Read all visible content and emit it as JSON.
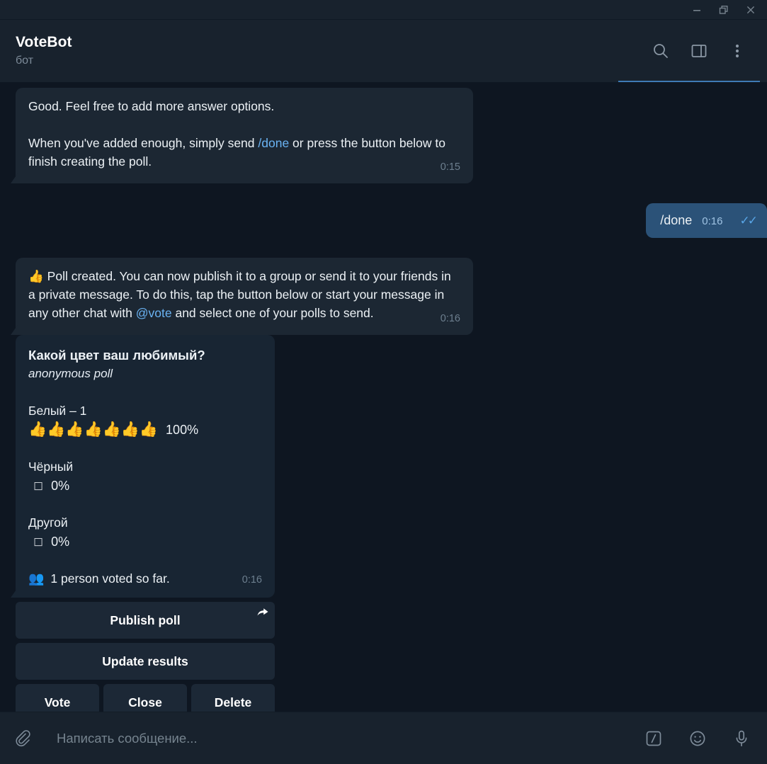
{
  "window": {
    "minimize_label": "Minimize",
    "restore_label": "Restore",
    "close_label": "Close"
  },
  "header": {
    "title": "VoteBot",
    "status": "бот",
    "search_icon": "search-icon",
    "panel_icon": "sidebar-toggle-icon",
    "menu_icon": "more-vertical-icon"
  },
  "messages": [
    {
      "id": "msg-instructions",
      "direction": "in",
      "paragraph1": "Good. Feel free to add more answer options.",
      "paragraph2_before": "When you've added enough, simply send ",
      "paragraph2_command": "/done",
      "paragraph2_after": " or press the button below to finish creating the poll.",
      "time": "0:15"
    },
    {
      "id": "msg-done",
      "direction": "out",
      "text": "/done",
      "time": "0:16",
      "ticks": "✓✓"
    },
    {
      "id": "msg-poll-created",
      "direction": "in",
      "emoji": "👍",
      "text_before": " Poll created. You can now publish it to a group or send it to your friends in a private message. To do this, tap the button below or start your message in any other chat with ",
      "mention": "@vote",
      "text_after": " and select one of your polls to send.",
      "time": "0:16"
    }
  ],
  "poll": {
    "question": "Какой цвет ваш любимый?",
    "subtitle": "anonymous poll",
    "options": [
      {
        "label": "Белый – 1",
        "emoji_bar": "👍👍👍👍👍👍👍",
        "box": "",
        "percent": "100%"
      },
      {
        "label": "Чёрный",
        "emoji_bar": "",
        "box": "◻",
        "percent": "0%"
      },
      {
        "label": "Другой",
        "emoji_bar": "",
        "box": "◻",
        "percent": "0%"
      }
    ],
    "voters_icon": "👥",
    "voters_text": "1 person voted so far.",
    "time": "0:16"
  },
  "keyboard": {
    "publish_label": "Publish poll",
    "publish_share_icon": "share-arrow-icon",
    "update_label": "Update results",
    "vote_label": "Vote",
    "close_label": "Close",
    "delete_label": "Delete"
  },
  "composer": {
    "attach_icon": "paperclip-icon",
    "placeholder": "Написать сообщение...",
    "value": "",
    "slash_icon": "slash-command-icon",
    "emoji_icon": "smiley-icon",
    "mic_icon": "microphone-icon"
  },
  "colors": {
    "app_background": "#0e1621",
    "header_background": "#18222d",
    "incoming_bubble": "#1c2733",
    "outgoing_bubble": "#2b5278",
    "poll_card": "#182533",
    "keyboard_button": "#1c2836",
    "accent_link": "#6ab3f3",
    "accent_underline": "#3e7ab5"
  }
}
